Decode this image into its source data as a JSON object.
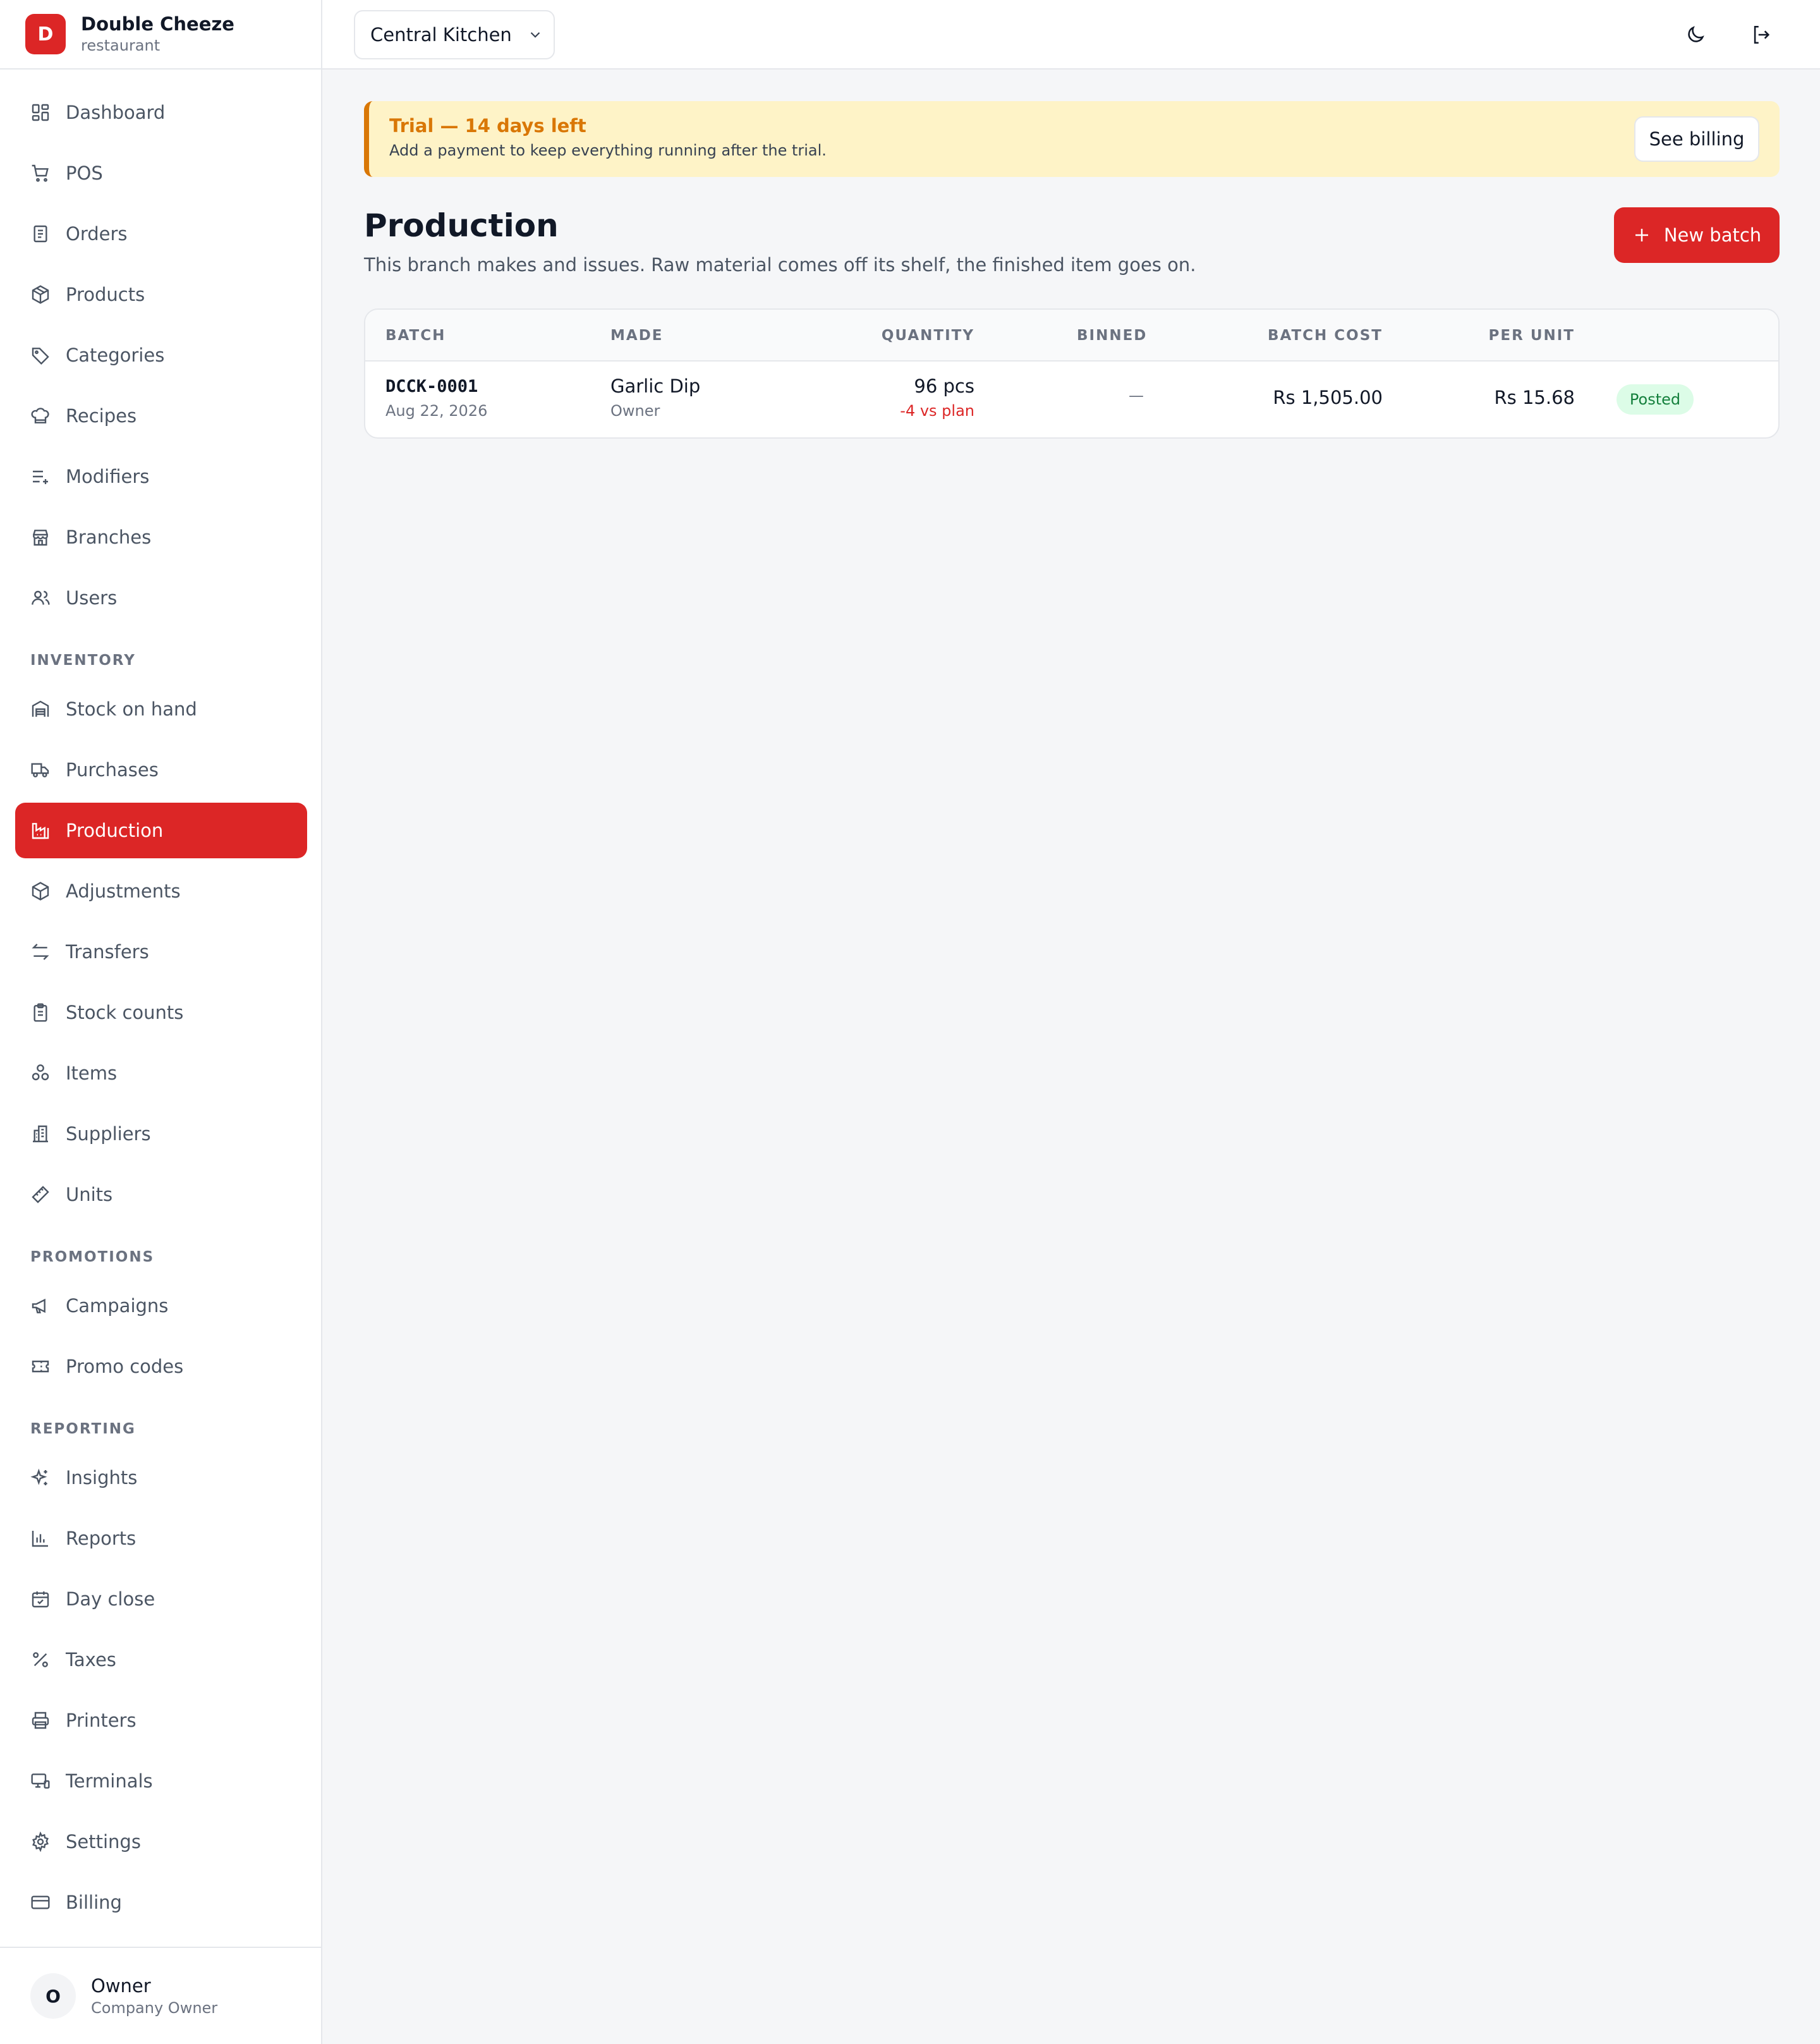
{
  "brand": {
    "logo_letter": "D",
    "name": "Double Cheeze",
    "subtitle": "restaurant"
  },
  "nav": {
    "main": [
      {
        "label": "Dashboard",
        "icon": "dashboard-icon"
      },
      {
        "label": "POS",
        "icon": "cart-icon"
      },
      {
        "label": "Orders",
        "icon": "receipt-icon"
      },
      {
        "label": "Products",
        "icon": "package-icon"
      },
      {
        "label": "Categories",
        "icon": "tag-icon"
      },
      {
        "label": "Recipes",
        "icon": "chef-hat-icon"
      },
      {
        "label": "Modifiers",
        "icon": "list-plus-icon"
      },
      {
        "label": "Branches",
        "icon": "store-icon"
      },
      {
        "label": "Users",
        "icon": "users-icon"
      }
    ],
    "inventory_title": "INVENTORY",
    "inventory": [
      {
        "label": "Stock on hand",
        "icon": "warehouse-icon"
      },
      {
        "label": "Purchases",
        "icon": "truck-icon"
      },
      {
        "label": "Production",
        "icon": "factory-icon",
        "active": true
      },
      {
        "label": "Adjustments",
        "icon": "box-icon"
      },
      {
        "label": "Transfers",
        "icon": "arrows-left-right-icon"
      },
      {
        "label": "Stock counts",
        "icon": "clipboard-icon"
      },
      {
        "label": "Items",
        "icon": "boxes-icon"
      },
      {
        "label": "Suppliers",
        "icon": "building-icon"
      },
      {
        "label": "Units",
        "icon": "ruler-icon"
      }
    ],
    "promotions_title": "PROMOTIONS",
    "promotions": [
      {
        "label": "Campaigns",
        "icon": "megaphone-icon"
      },
      {
        "label": "Promo codes",
        "icon": "ticket-icon"
      }
    ],
    "reporting_title": "REPORTING",
    "reporting": [
      {
        "label": "Insights",
        "icon": "sparkles-icon"
      },
      {
        "label": "Reports",
        "icon": "bar-chart-icon"
      },
      {
        "label": "Day close",
        "icon": "calendar-check-icon"
      },
      {
        "label": "Taxes",
        "icon": "percent-icon"
      },
      {
        "label": "Printers",
        "icon": "printer-icon"
      },
      {
        "label": "Terminals",
        "icon": "monitor-icon"
      },
      {
        "label": "Settings",
        "icon": "gear-icon"
      },
      {
        "label": "Billing",
        "icon": "credit-card-icon"
      }
    ]
  },
  "user": {
    "initial": "O",
    "name": "Owner",
    "role": "Company Owner"
  },
  "header": {
    "branch": "Central Kitchen"
  },
  "trial": {
    "title": "Trial — 14 days left",
    "text": "Add a payment to keep everything running after the trial.",
    "button": "See billing"
  },
  "page": {
    "title": "Production",
    "subtitle": "This branch makes and issues. Raw material comes off its shelf, the finished item goes on.",
    "new_batch": "New batch"
  },
  "table": {
    "columns": [
      "BATCH",
      "MADE",
      "QUANTITY",
      "BINNED",
      "BATCH COST",
      "PER UNIT"
    ],
    "rows": [
      {
        "batch": "DCCK-0001",
        "date": "Aug 22, 2026",
        "made": "Garlic Dip",
        "made_by": "Owner",
        "quantity": "96 pcs",
        "variance": "-4 vs plan",
        "binned": "—",
        "batch_cost": "Rs 1,505.00",
        "per_unit": "Rs 15.68",
        "status": "Posted"
      }
    ]
  },
  "colors": {
    "accent": "#dc2626",
    "trial_bg": "#fef3c7",
    "trial_accent": "#d97706",
    "posted_bg": "#dcfce7",
    "posted_text": "#15803d"
  }
}
